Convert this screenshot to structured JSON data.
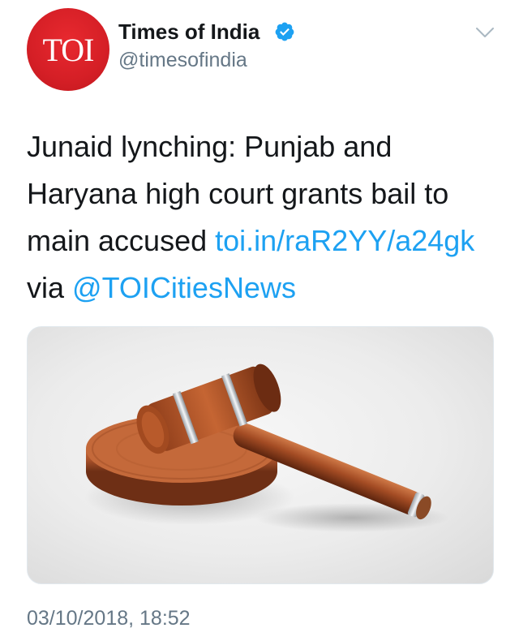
{
  "author": {
    "avatar_text": "TOI",
    "name": "Times of India",
    "handle": "@timesofindia",
    "verified_icon": "verified-badge-icon",
    "menu_icon": "chevron-down-icon"
  },
  "tweet": {
    "text_before": "Junaid lynching: Punjab and Haryana high court grants bail to main accused ",
    "link1": "toi.in/raR2YY/a24gk",
    "text_via": " via ",
    "mention": "@TOICitiesNews",
    "timestamp": "03/10/2018, 18:52"
  },
  "media": {
    "subject": "gavel-on-sound-block-image"
  },
  "colors": {
    "link": "#1da1f2",
    "secondary_text": "#657786",
    "avatar_red": "#d51f26",
    "verified_blue": "#1da1f2"
  }
}
